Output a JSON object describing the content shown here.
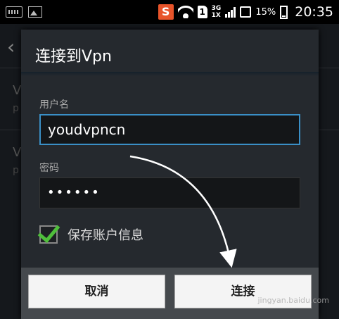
{
  "status_bar": {
    "battery_percent": "15%",
    "time": "20:35",
    "network_top": "3G",
    "network_bottom": "1X",
    "sim_label": "1",
    "app_icon_letter": "S"
  },
  "background": {
    "items": [
      {
        "title": "V",
        "sub": "p"
      },
      {
        "title": "V",
        "sub": "p"
      }
    ]
  },
  "dialog": {
    "title": "连接到Vpn",
    "username_label": "用户名",
    "username_value": "youdvpncn",
    "password_label": "密码",
    "password_value": "••••••",
    "save_account_label": "保存账户信息",
    "save_account_checked": true,
    "cancel_label": "取消",
    "connect_label": "连接"
  },
  "watermark": "jingyan.baidu.com",
  "colors": {
    "focus_border": "#3a8fc6",
    "checkmark": "#4fbf3b"
  }
}
